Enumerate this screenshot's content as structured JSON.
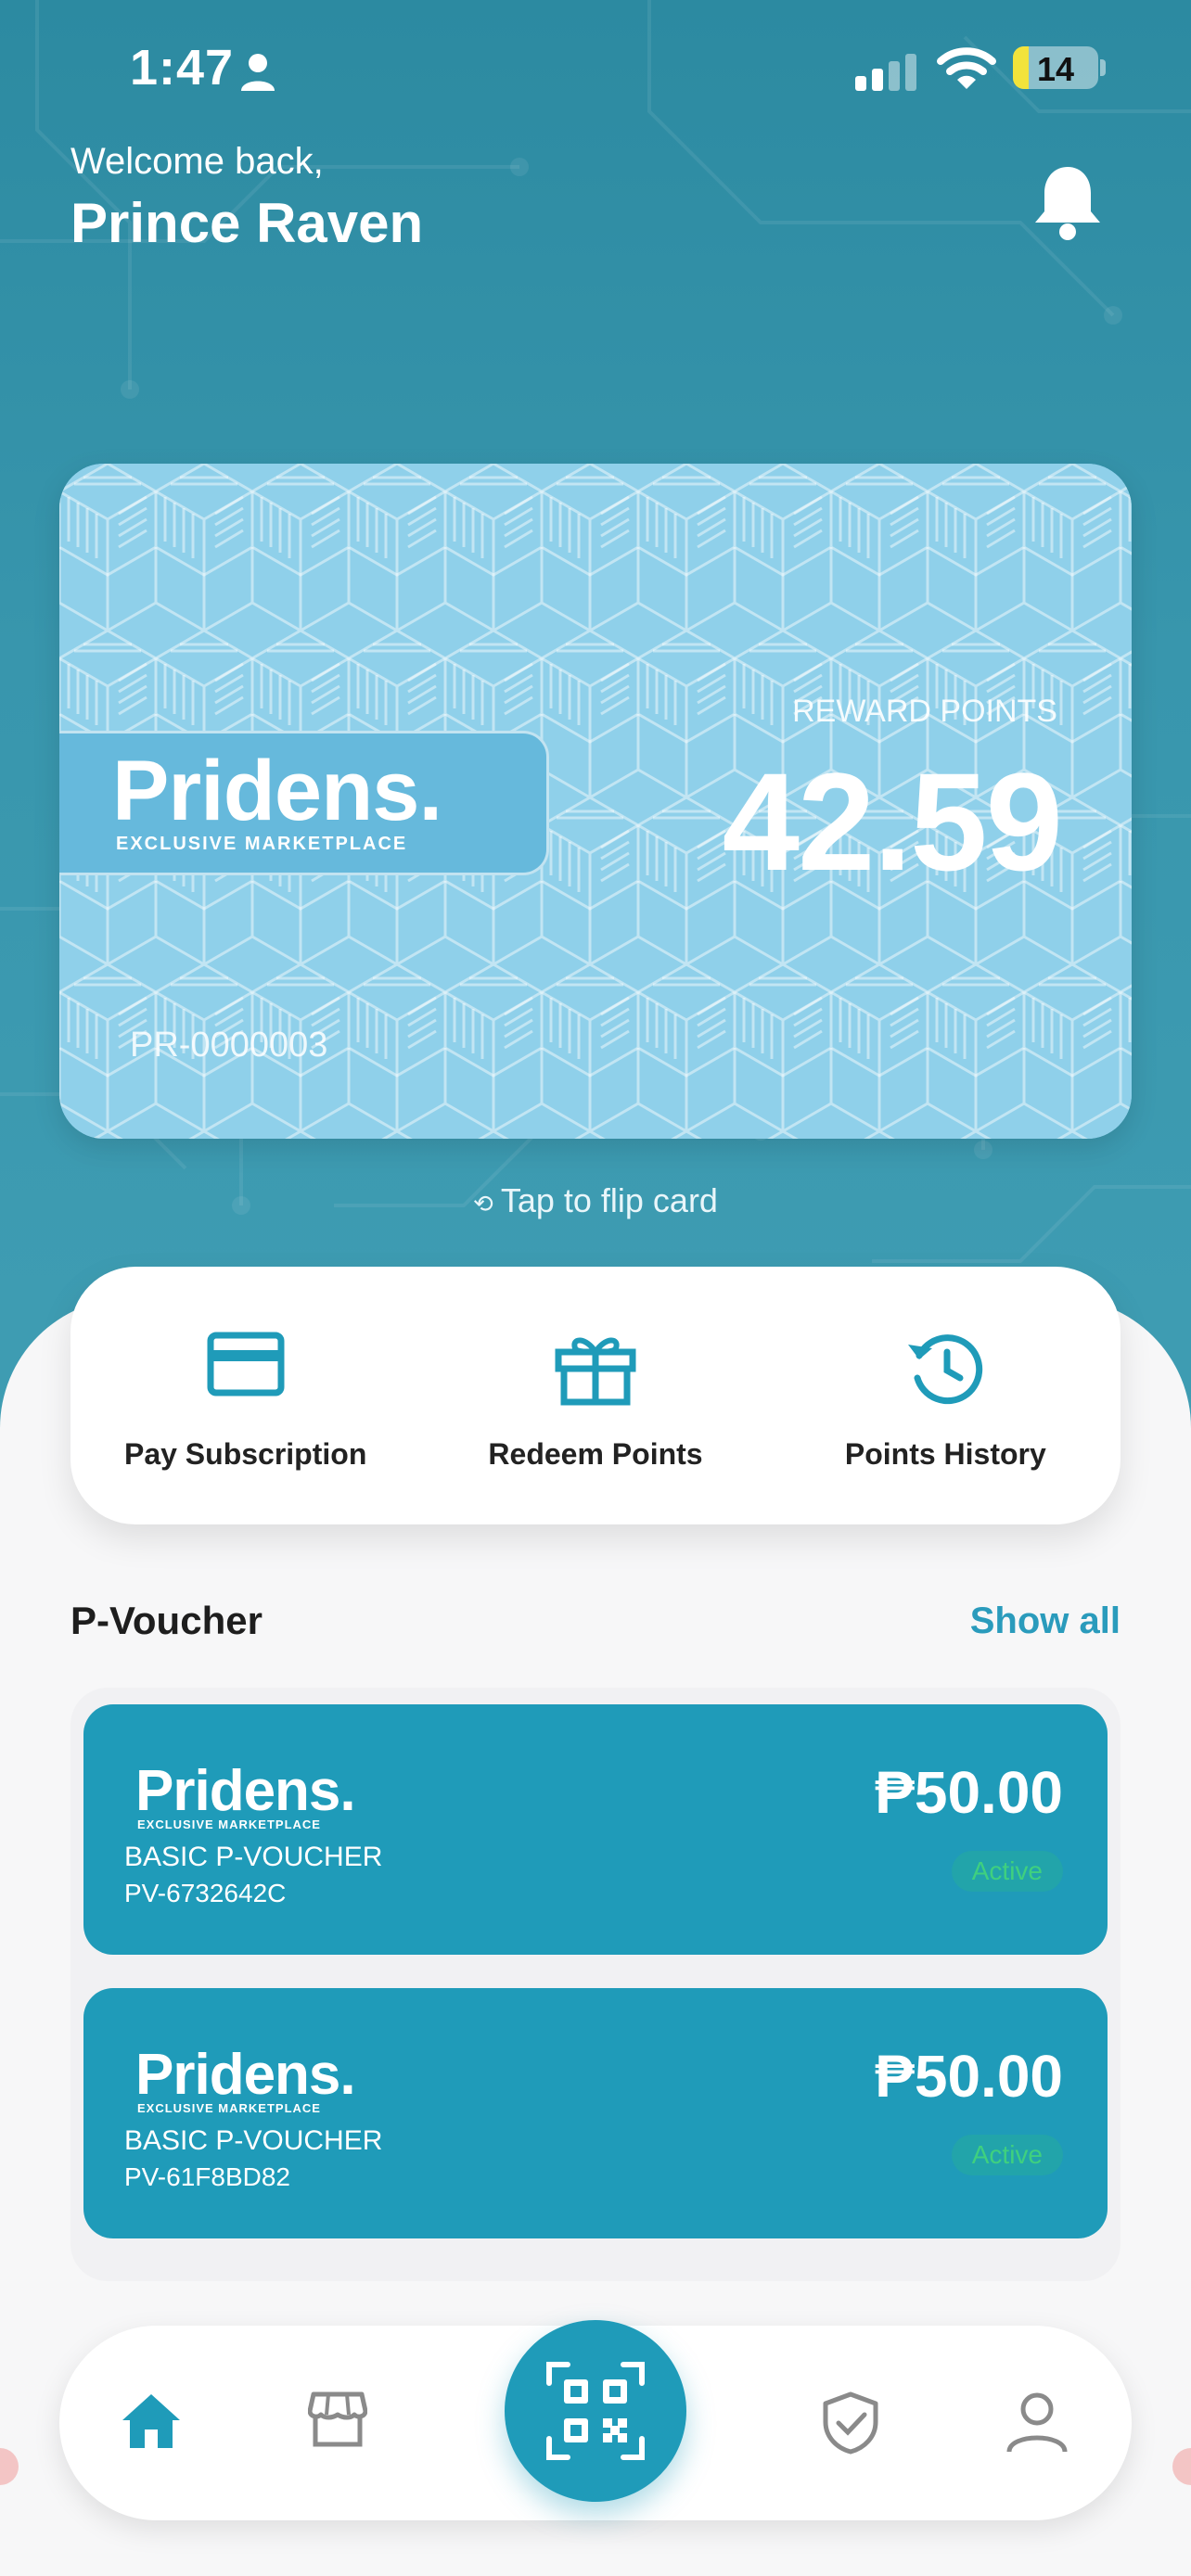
{
  "status_bar": {
    "time": "1:47",
    "battery": "14"
  },
  "header": {
    "greeting": "Welcome back,",
    "name": "Prince Raven"
  },
  "card": {
    "brand": "Pridens.",
    "tagline": "EXCLUSIVE MARKETPLACE",
    "points_label": "REWARD POINTS",
    "points_value": "42.59",
    "member_id": "PR-0000003",
    "flip_hint": "Tap to flip card"
  },
  "actions": [
    {
      "label": "Pay Subscription",
      "icon": "credit-card-icon"
    },
    {
      "label": "Redeem Points",
      "icon": "gift-icon"
    },
    {
      "label": "Points History",
      "icon": "history-icon"
    }
  ],
  "vouchers_section": {
    "title": "P-Voucher",
    "show_all": "Show all",
    "items": [
      {
        "brand": "Pridens.",
        "tagline": "EXCLUSIVE MARKETPLACE",
        "type": "BASIC P-VOUCHER",
        "code": "PV-6732642C",
        "amount": "₱50.00",
        "status": "Active"
      },
      {
        "brand": "Pridens.",
        "tagline": "EXCLUSIVE MARKETPLACE",
        "type": "BASIC P-VOUCHER",
        "code": "PV-61F8BD82",
        "amount": "₱50.00",
        "status": "Active"
      }
    ]
  },
  "bottom_nav": [
    {
      "icon": "home-icon",
      "active": true
    },
    {
      "icon": "store-icon",
      "active": false
    },
    {
      "icon": "qr-scan-icon",
      "active": false
    },
    {
      "icon": "shield-check-icon",
      "active": false
    },
    {
      "icon": "profile-icon",
      "active": false
    }
  ],
  "colors": {
    "accent": "#1f9bb9",
    "hero": "#2f8ea5",
    "status_active": "#3fd07f"
  }
}
